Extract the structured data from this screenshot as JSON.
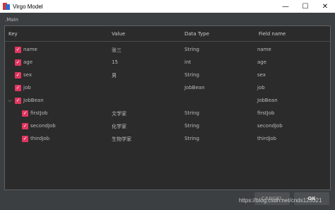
{
  "window": {
    "title": "Virgo Model",
    "minimize": "—",
    "maximize": "☐",
    "close": "✕"
  },
  "main_label": ".Main",
  "table": {
    "headers": {
      "key": "Key",
      "value": "Value",
      "data_type": "Data Type",
      "field_name": "Field name"
    },
    "rows": [
      {
        "key": "name",
        "value": "张三",
        "data_type": "String",
        "field_name": "name"
      },
      {
        "key": "age",
        "value": "15",
        "data_type": "int",
        "field_name": "age"
      },
      {
        "key": "sex",
        "value": "男",
        "data_type": "String",
        "field_name": "sex"
      },
      {
        "key": "job",
        "value": "",
        "data_type": "JobBean",
        "field_name": "job"
      },
      {
        "key": "JobBean",
        "value": "",
        "data_type": "",
        "field_name": "JobBean"
      },
      {
        "key": "firstJob",
        "value": "文学家",
        "data_type": "String",
        "field_name": "firstJob"
      },
      {
        "key": "secondJob",
        "value": "化学家",
        "data_type": "String",
        "field_name": "secondJob"
      },
      {
        "key": "thirdJob",
        "value": "生物学家",
        "data_type": "String",
        "field_name": "thirdJob"
      }
    ]
  },
  "buttons": {
    "cancel": "CANCEL",
    "ok": "OK"
  },
  "watermark": "https://blog.csdn.net/cnds123321",
  "colors": {
    "checkbox": "#e0365f",
    "background": "#3c3f41",
    "panel": "#2b2b2b"
  }
}
